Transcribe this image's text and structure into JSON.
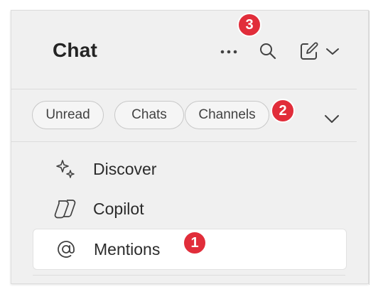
{
  "header": {
    "title": "Chat",
    "more_icon": "more-horizontal-icon",
    "search_icon": "search-icon",
    "compose_icon": "compose-icon",
    "compose_menu_icon": "chevron-down-icon"
  },
  "filters": [
    {
      "label": "Unread"
    },
    {
      "label": "Chats"
    },
    {
      "label": "Channels"
    }
  ],
  "filter_expand_icon": "chevron-down-icon",
  "nav": [
    {
      "label": "Discover",
      "icon": "sparkle-icon"
    },
    {
      "label": "Copilot",
      "icon": "copilot-icon"
    },
    {
      "label": "Mentions",
      "icon": "at-sign-icon",
      "selected": true
    }
  ],
  "badges": [
    {
      "value": "1"
    },
    {
      "value": "2"
    },
    {
      "value": "3"
    }
  ],
  "colors": {
    "panel_bg": "#f0f0f0",
    "badge_red": "#e12d3a",
    "text": "#242424",
    "pill_border": "#c8c8c8",
    "selected_bg": "#ffffff"
  }
}
